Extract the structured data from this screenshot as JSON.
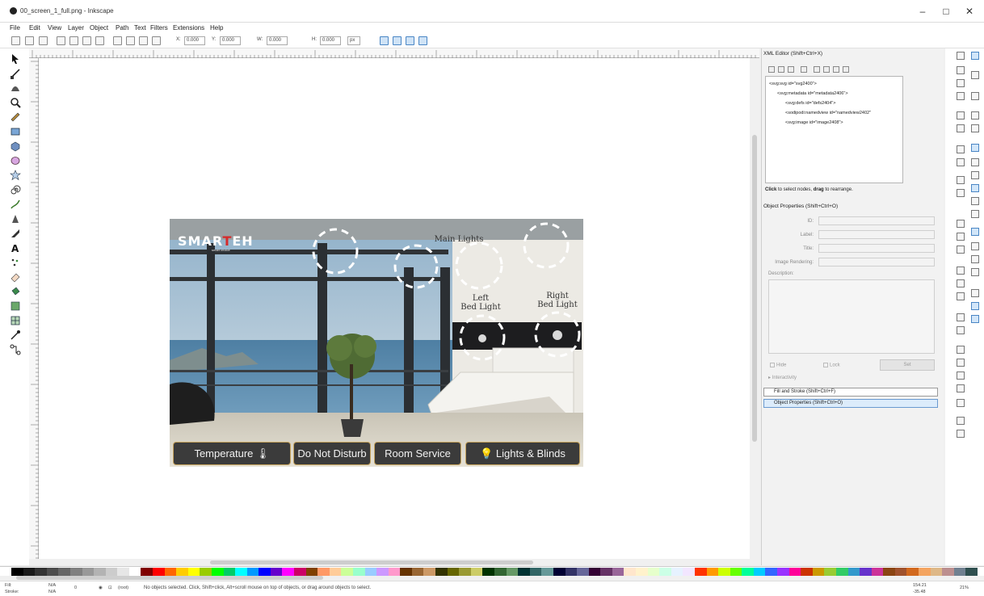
{
  "window": {
    "title": "00_screen_1_full.png - Inkscape",
    "minimize": "–",
    "maximize": "□",
    "close": "✕"
  },
  "menu": [
    "File",
    "Edit",
    "View",
    "Layer",
    "Object",
    "Path",
    "Text",
    "Filters",
    "Extensions",
    "Help"
  ],
  "toolbar": {
    "x_label": "X:",
    "x_value": "0.000",
    "y_label": "Y:",
    "y_value": "0.000",
    "w_label": "W:",
    "w_value": "0.000",
    "h_label": "H:",
    "h_value": "0.000",
    "unit": "px"
  },
  "scene": {
    "logo_main_a": "SMAR",
    "logo_main_b": "T",
    "logo_main_c": "EH",
    "logo_sub": "smart choice",
    "main_lights": "Main Lights",
    "left_bed_light_1": "Left",
    "left_bed_light_2": "Bed Light",
    "right_bed_light_1": "Right",
    "right_bed_light_2": "Bed Light",
    "buttons": [
      "Temperature",
      "Do Not Disturb",
      "Room Service",
      "Lights & Blinds"
    ]
  },
  "xml_editor": {
    "title": "XML Editor (Shift+Ctrl+X)",
    "nodes": [
      "<svg:svg id=\"svg2400\">",
      "<svg:metadata id=\"metadata2406\">",
      "<svg:defs id=\"defs2404\">",
      "<sodipodi:namedview id=\"namedview2402\"",
      "<svg:image id=\"image2408\">"
    ],
    "hint_bold": "Click",
    "hint_text": " to select nodes, ",
    "hint_bold2": "drag",
    "hint_text2": " to rearrange."
  },
  "object_properties": {
    "title": "Object Properties (Shift+Ctrl+O)",
    "id_label": "ID:",
    "label_label": "Label:",
    "title_label": "Title:",
    "rendering_label": "Image Rendering:",
    "description_label": "Description:",
    "hide_label": "Hide",
    "lock_label": "Lock",
    "set_label": "Set",
    "interactivity_label": "Interactivity"
  },
  "dock_tabs": {
    "fill_stroke": "Fill and Stroke (Shift+Ctrl+F)",
    "object_props": "Object Properties (Shift+Ctrl+O)"
  },
  "status": {
    "fill_label": "Fill:",
    "fill_value": "N/A",
    "stroke_label": "Stroke:",
    "stroke_value": "N/A",
    "opacity_value": "0",
    "layer_value": "(root)",
    "message": "No objects selected. Click, Shift+click, Alt+scroll mouse on top of objects, or drag around objects to select.",
    "coord_x": "154.21",
    "coord_y": "-35.48",
    "zoom": "21%"
  },
  "palette_colors": [
    "#000000",
    "#1a1a1a",
    "#333333",
    "#4d4d4d",
    "#666666",
    "#808080",
    "#999999",
    "#b3b3b3",
    "#cccccc",
    "#e6e6e6",
    "#ffffff",
    "#800000",
    "#ff0000",
    "#ff6600",
    "#ffcc00",
    "#ffff00",
    "#99cc00",
    "#00ff00",
    "#00cc66",
    "#00ffff",
    "#0099ff",
    "#0000ff",
    "#6600cc",
    "#ff00ff",
    "#cc0066",
    "#804000",
    "#ff9966",
    "#ffcc99",
    "#ccff99",
    "#99ffcc",
    "#99ccff",
    "#cc99ff",
    "#ff99cc",
    "#663300",
    "#996633",
    "#cc9966",
    "#333300",
    "#666600",
    "#999933",
    "#cccc66",
    "#003300",
    "#336633",
    "#669966",
    "#003333",
    "#336666",
    "#669999",
    "#000033",
    "#333366",
    "#666699",
    "#330033",
    "#663366",
    "#996699",
    "#ffe6cc",
    "#fff2cc",
    "#e6ffcc",
    "#ccffe6",
    "#e6f2ff",
    "#f2e6ff",
    "#ff3300",
    "#ff9900",
    "#ccff00",
    "#66ff00",
    "#00ff99",
    "#00ccff",
    "#3366ff",
    "#9933ff",
    "#ff0099",
    "#cc3300",
    "#cc9900",
    "#99cc33",
    "#33cc66",
    "#3399cc",
    "#6633cc",
    "#cc3399",
    "#8b4513",
    "#a0522d",
    "#d2691e",
    "#f4a460",
    "#deb887",
    "#bc8f8f",
    "#708090",
    "#2f4f4f"
  ]
}
